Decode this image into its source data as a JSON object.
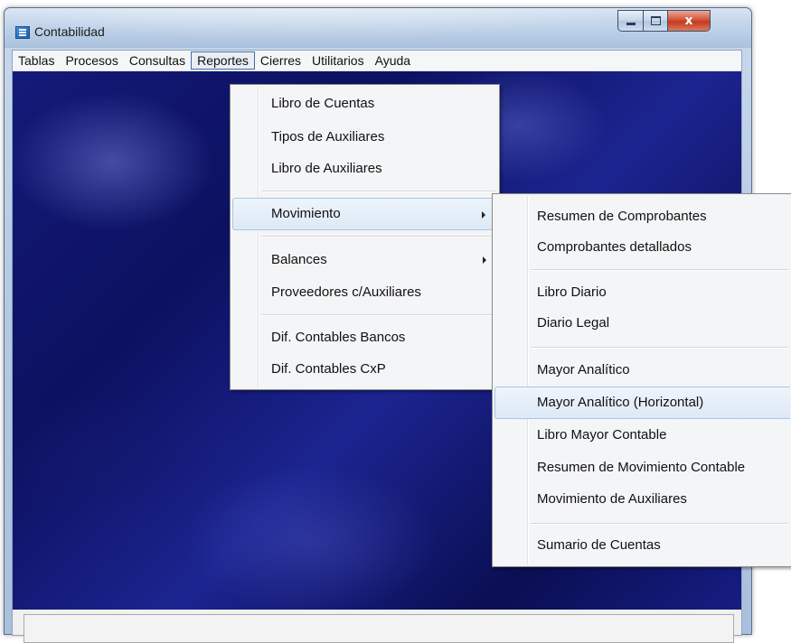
{
  "window": {
    "title": "Contabilidad",
    "close_glyph": "x"
  },
  "menubar": [
    "Tablas",
    "Procesos",
    "Consultas",
    "Reportes",
    "Cierres",
    "Utilitarios",
    "Ayuda"
  ],
  "reportes_menu": {
    "libro_cuentas": "Libro de Cuentas",
    "tipos_auxiliares": "Tipos de Auxiliares",
    "libro_auxiliares": "Libro de Auxiliares",
    "movimiento": "Movimiento",
    "balances": "Balances",
    "proveedores": "Proveedores c/Auxiliares",
    "dif_bancos": "Dif. Contables Bancos",
    "dif_cxp": "Dif. Contables CxP"
  },
  "movimiento_submenu": {
    "resumen_comprobantes": "Resumen de Comprobantes",
    "comprobantes_detallados": "Comprobantes detallados",
    "libro_diario": "Libro Diario",
    "diario_legal": "Diario Legal",
    "mayor_analitico": "Mayor Analítico",
    "mayor_analitico_h": "Mayor Analítico (Horizontal)",
    "libro_mayor": "Libro Mayor Contable",
    "resumen_mov": "Resumen de Movimiento Contable",
    "mov_auxiliares": "Movimiento de Auxiliares",
    "sumario_cuentas": "Sumario de Cuentas"
  },
  "icons": {
    "app": "ledger-app-icon",
    "minimize": "minimize-icon",
    "maximize": "maximize-icon",
    "close": "close-icon",
    "submenu": "submenu-arrow-icon"
  }
}
